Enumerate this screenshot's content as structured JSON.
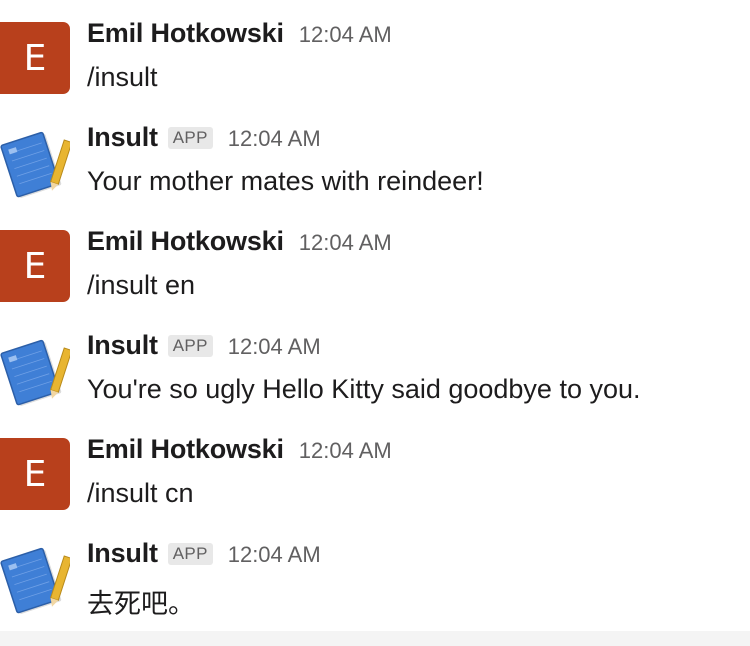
{
  "messages": [
    {
      "sender": "Emil Hotkowski",
      "avatar_letter": "E",
      "time": "12:04 AM",
      "text": "/insult"
    },
    {
      "sender": "Insult",
      "badge": "APP",
      "time": "12:04 AM",
      "text": "Your mother mates with reindeer!"
    },
    {
      "sender": "Emil Hotkowski",
      "avatar_letter": "E",
      "time": "12:04 AM",
      "text": "/insult en"
    },
    {
      "sender": "Insult",
      "badge": "APP",
      "time": "12:04 AM",
      "text": "You're so ugly Hello Kitty said goodbye to you."
    },
    {
      "sender": "Emil Hotkowski",
      "avatar_letter": "E",
      "time": "12:04 AM",
      "text": "/insult cn"
    },
    {
      "sender": "Insult",
      "badge": "APP",
      "time": "12:04 AM",
      "text": "去死吧。"
    }
  ],
  "colors": {
    "user_avatar": "#b8401c",
    "app_icon_blue": "#3f7fd6",
    "app_icon_pencil": "#e8b531"
  },
  "icons": {
    "app_avatar": "notebook-pencil-icon"
  }
}
